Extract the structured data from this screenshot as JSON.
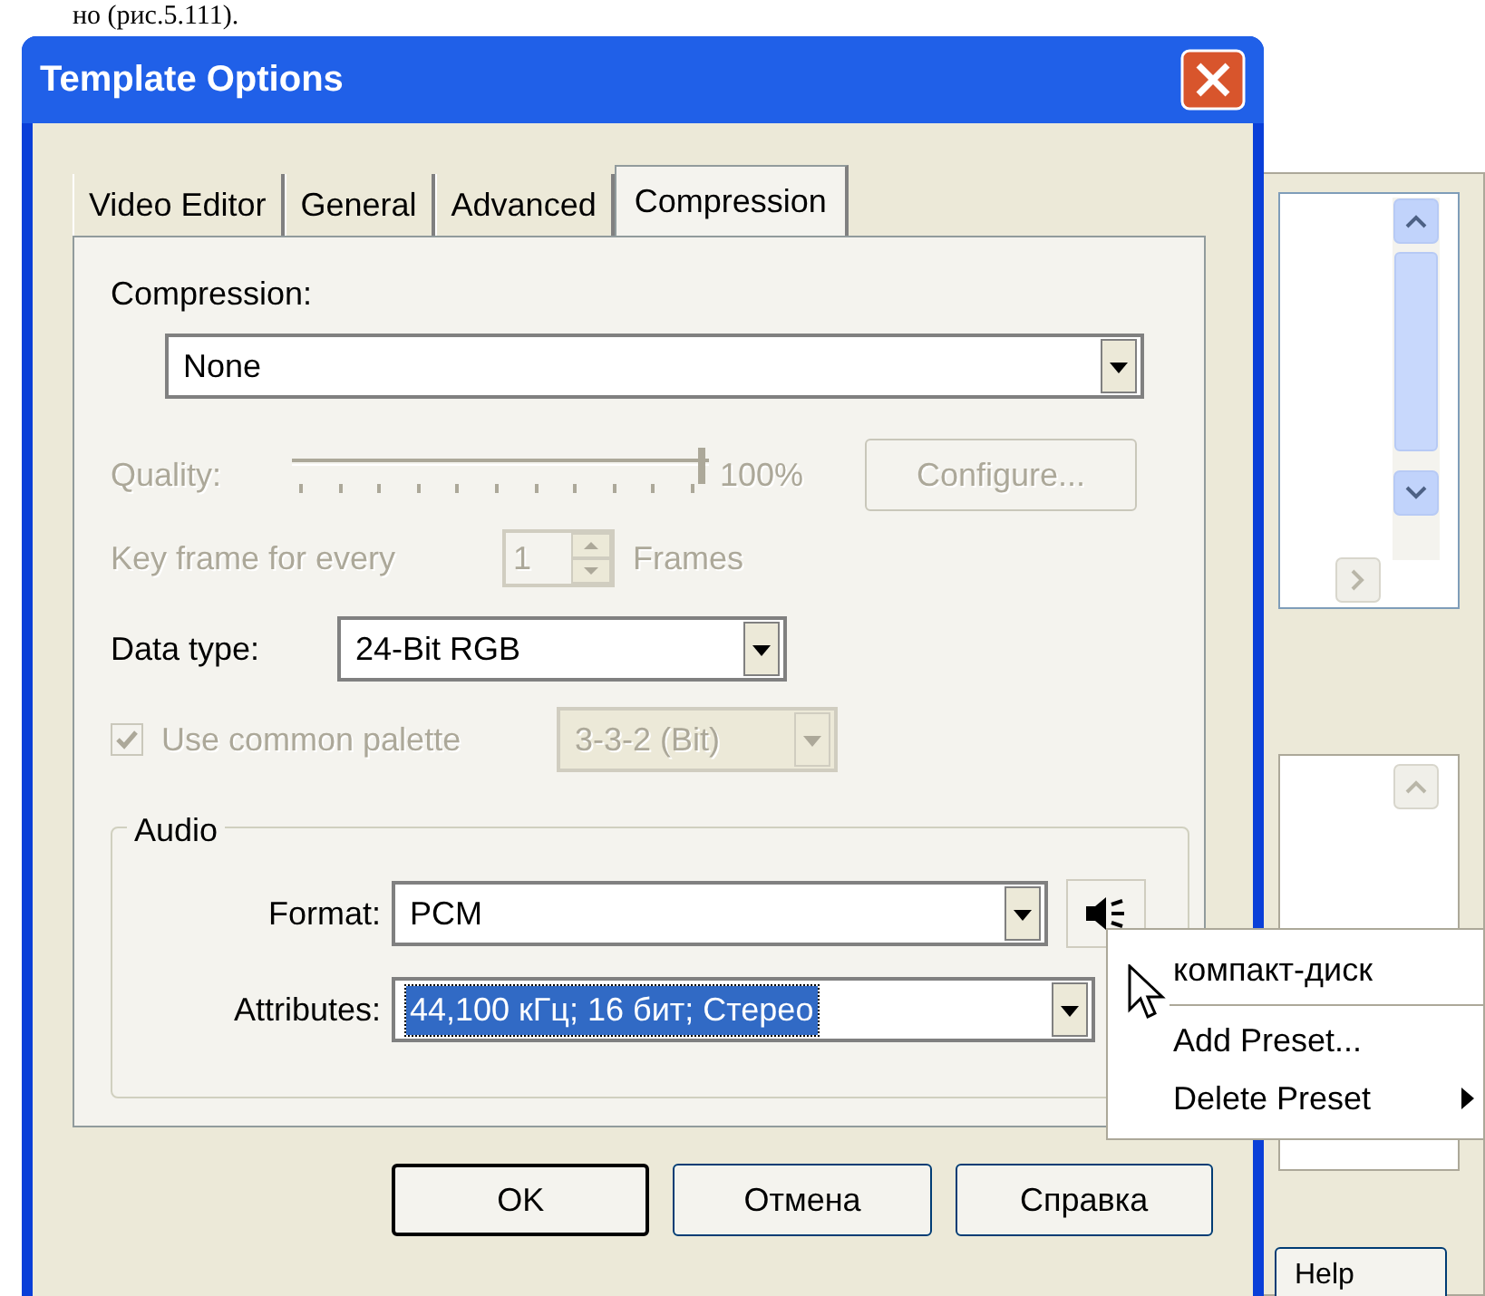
{
  "document_text": "но (рис.5.111).",
  "dialog": {
    "title": "Template Options",
    "tabs": [
      {
        "label": "Video Editor",
        "selected": false
      },
      {
        "label": "General",
        "selected": false
      },
      {
        "label": "Advanced",
        "selected": false
      },
      {
        "label": "Compression",
        "selected": true
      }
    ],
    "compression": {
      "label": "Compression:",
      "value": "None"
    },
    "quality": {
      "label": "Quality:",
      "level": 1,
      "reading": "100%",
      "disabled": true
    },
    "configure_button": {
      "label": "Configure...",
      "disabled": true
    },
    "key_frame": {
      "label": "Key frame for every",
      "value": "1",
      "unit": "Frames",
      "disabled": true
    },
    "data_type": {
      "label": "Data type:",
      "value": "24-Bit RGB"
    },
    "common_palette": {
      "label": "Use common palette",
      "checked": true,
      "disabled": true,
      "value": "3-3-2 (Bit)"
    },
    "audio": {
      "title": "Audio",
      "format": {
        "label": "Format:",
        "value": "PCM"
      },
      "attributes": {
        "label": "Attributes:",
        "value": "44,100 кГц; 16 бит; Стерео",
        "selected": true
      }
    },
    "buttons": [
      {
        "label": "OK",
        "default": true
      },
      {
        "label": "Отмена",
        "default": false
      },
      {
        "label": "Справка",
        "default": false
      }
    ]
  },
  "context_menu": {
    "items": [
      {
        "label": "компакт-диск",
        "kind": "item"
      },
      {
        "kind": "separator"
      },
      {
        "label": "Add Preset...",
        "kind": "item"
      },
      {
        "label": "Delete Preset",
        "kind": "submenu"
      }
    ]
  },
  "background_window": {
    "button": "Help"
  }
}
